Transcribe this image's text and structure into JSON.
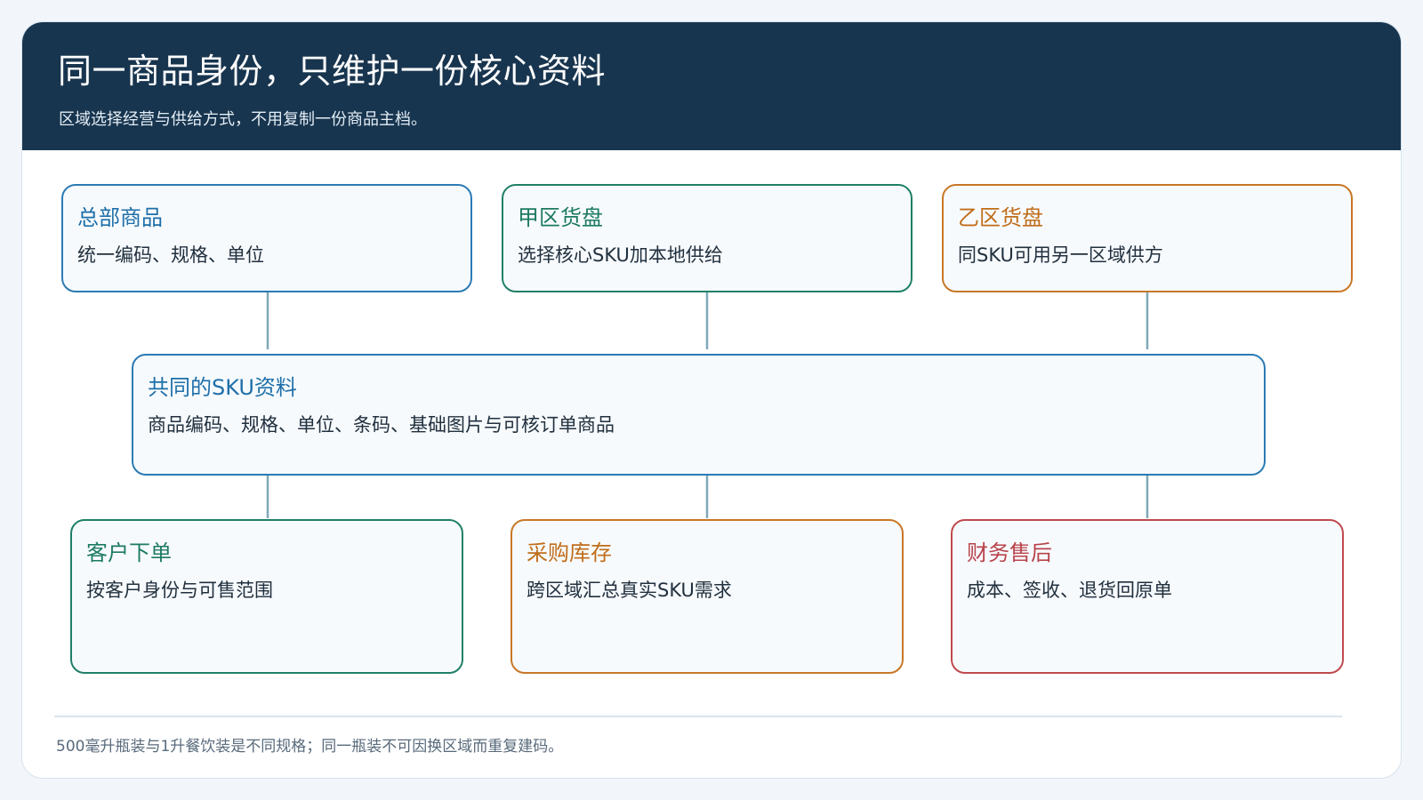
{
  "header": {
    "title": "同一商品身份，只维护一份核心资料",
    "subtitle": "区域选择经营与供给方式，不用复制一份商品主档。"
  },
  "top_row": [
    {
      "title": "总部商品",
      "desc": "统一编码、规格、单位",
      "color": "#2b7bb5"
    },
    {
      "title": "甲区货盘",
      "desc": "选择核心SKU加本地供给",
      "color": "#1f8067"
    },
    {
      "title": "乙区货盘",
      "desc": "同SKU可用另一区域供方",
      "color": "#c87726"
    }
  ],
  "center": {
    "title": "共同的SKU资料",
    "desc": "商品编码、规格、单位、条码、基础图片与可核订单商品",
    "color": "#2b7bb5"
  },
  "bottom_row": [
    {
      "title": "客户下单",
      "desc": "按客户身份与可售范围",
      "color": "#1f8067"
    },
    {
      "title": "采购库存",
      "desc": "跨区域汇总真实SKU需求",
      "color": "#c87726"
    },
    {
      "title": "财务售后",
      "desc": "成本、签收、退货回原单",
      "color": "#c04a4e"
    }
  ],
  "footer": {
    "note": "500毫升瓶装与1升餐饮装是不同规格；同一瓶装不可因换区域而重复建码。"
  },
  "colors": {
    "header_bg": "#18354f",
    "connector": "#7fa8b8"
  }
}
